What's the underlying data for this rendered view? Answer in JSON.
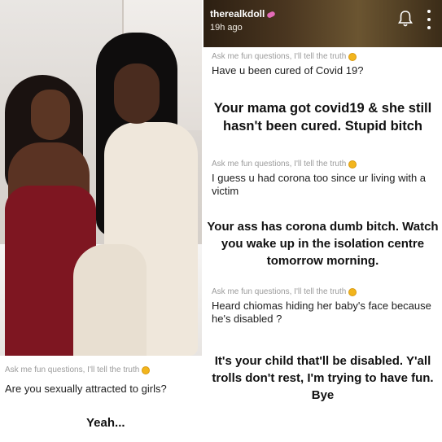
{
  "left_card": {
    "prompt": "Ask me fun questions, I'll tell the truth",
    "question": "Are you sexually attracted to girls?",
    "answer": "Yeah..."
  },
  "story": {
    "username": "therealkdoll",
    "time": "19h ago",
    "icons": [
      "bell-icon",
      "more-vertical-icon"
    ],
    "items": [
      {
        "prompt": "Ask me fun questions, I'll tell the truth",
        "question": "Have u been cured of Covid 19?",
        "reply": "Your mama got covid19 & she still hasn't been cured. Stupid bitch"
      },
      {
        "prompt": "Ask me fun questions, I'll tell the truth",
        "question": "I guess u had corona too since ur living with a victim",
        "reply": "Your ass has corona dumb bitch. Watch you wake up in the isolation centre tomorrow morning."
      },
      {
        "prompt": "Ask me fun questions, I'll tell the truth",
        "question": "Heard chiomas hiding her baby's face because he's disabled ?",
        "reply": "It's your child that'll be disabled. Y'all trolls don't rest, I'm trying to have fun.  Bye"
      }
    ]
  },
  "colors": {
    "prompt_gray": "#9b9b9b",
    "emoji_yellow": "#f2b51d",
    "dress_red": "#7e1621"
  }
}
